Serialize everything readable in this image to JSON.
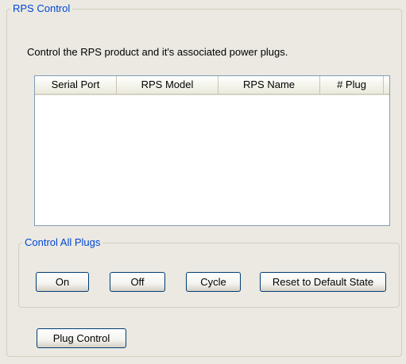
{
  "rps_group": {
    "title": "RPS Control"
  },
  "description": "Control the RPS product and it's associated power plugs.",
  "table": {
    "columns": [
      "Serial Port",
      "RPS Model",
      "RPS Name",
      "# Plug"
    ],
    "rows": []
  },
  "control_all_plugs": {
    "title": "Control All Plugs",
    "buttons": {
      "on": "On",
      "off": "Off",
      "cycle": "Cycle",
      "reset": "Reset to Default State"
    }
  },
  "plug_control_button": "Plug Control",
  "colors": {
    "group_title": "#0046d5",
    "panel_bg": "#ebe9e1",
    "button_border": "#003c74"
  }
}
